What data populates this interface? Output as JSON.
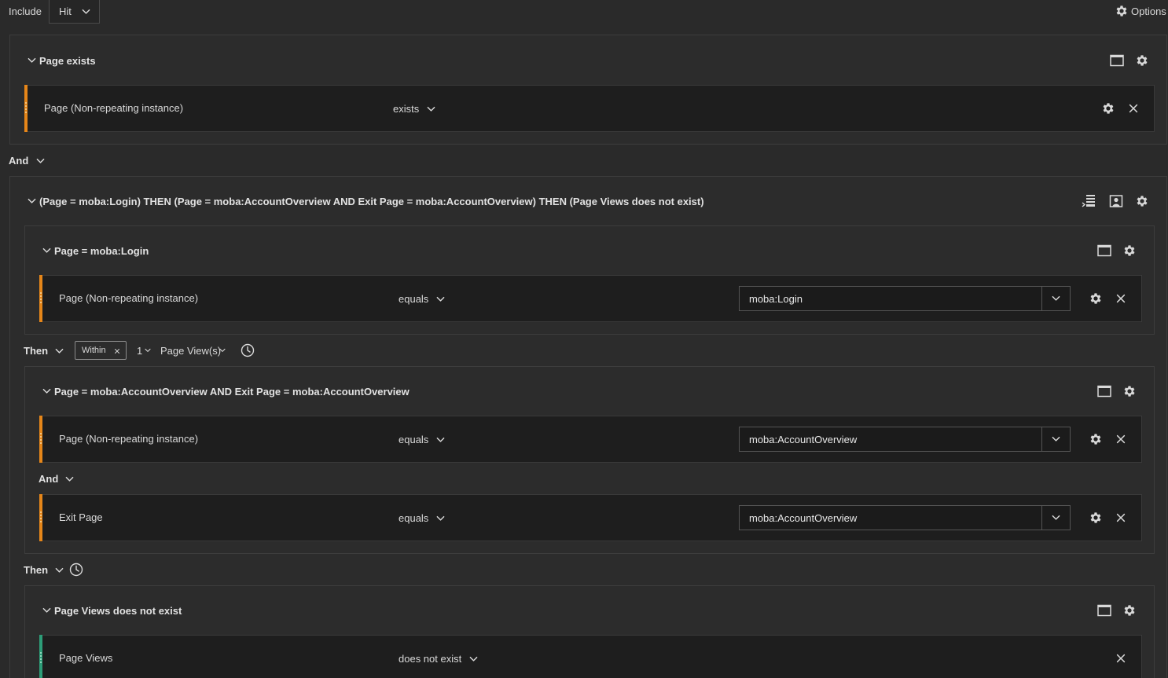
{
  "topbar": {
    "include_label": "Include",
    "hit_select": "Hit",
    "options_label": "Options"
  },
  "container1": {
    "title": "Page exists",
    "rule": {
      "dimension": "Page (Non-repeating instance)",
      "operator": "exists"
    }
  },
  "and_connector_1": "And",
  "sequence": {
    "title": "(Page = moba:Login) THEN (Page = moba:AccountOverview AND Exit Page = moba:AccountOverview) THEN (Page Views does not exist)",
    "step1": {
      "title": "Page = moba:Login",
      "rule": {
        "dimension": "Page (Non-repeating instance)",
        "operator": "equals",
        "value": "moba:Login"
      }
    },
    "then1": {
      "label": "Then",
      "within_label": "Within",
      "within_count": "1",
      "within_unit": "Page View(s)"
    },
    "step2": {
      "title": "Page = moba:AccountOverview AND Exit Page = moba:AccountOverview",
      "rule1": {
        "dimension": "Page (Non-repeating instance)",
        "operator": "equals",
        "value": "moba:AccountOverview"
      },
      "and_label": "And",
      "rule2": {
        "dimension": "Exit Page",
        "operator": "equals",
        "value": "moba:AccountOverview"
      }
    },
    "then2": {
      "label": "Then"
    },
    "step3": {
      "title": "Page Views does not exist",
      "rule": {
        "dimension": "Page Views",
        "operator": "does not exist"
      }
    }
  },
  "colors": {
    "dimension_accent": "#e68619",
    "metric_accent": "#2d9d78",
    "background": "#2a2a2a",
    "row_background": "#1e1e1e"
  },
  "icons": [
    "chevron-down-icon",
    "gear-icon",
    "close-icon",
    "maximize-icon",
    "clock-icon",
    "sequence-list-icon",
    "visitor-icon"
  ]
}
